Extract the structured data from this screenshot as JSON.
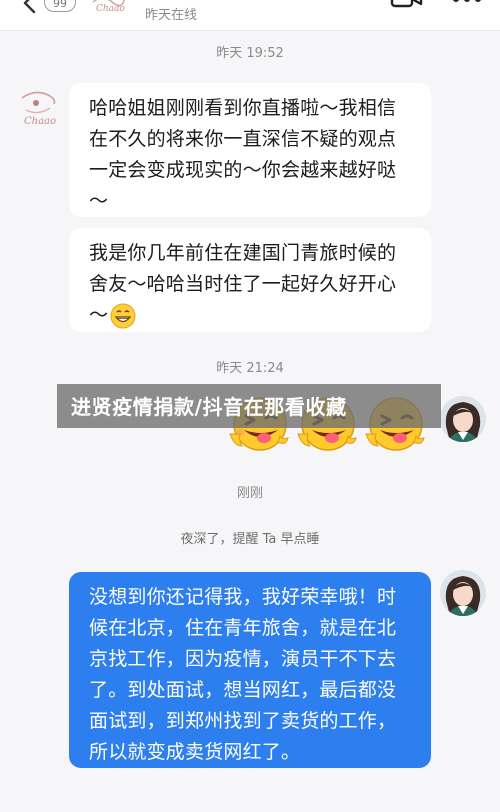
{
  "header": {
    "unread_count": "99",
    "contact_status": "昨天在线"
  },
  "chat": {
    "timestamps": [
      "昨天 19:52",
      "昨天 21:24",
      "刚刚"
    ],
    "messages_in": [
      {
        "lines": [
          "哈哈姐姐刚刚看到你直播啦～我相信",
          "在不久的将来你一直深信不疑的观点",
          "一定会变成现实的～你会越来越好哒",
          "～"
        ]
      },
      {
        "lines": [
          "我是你几年前住在建国门青旅时候的",
          "舍友～哈哈当时住了一起好久好开心",
          "～"
        ]
      }
    ],
    "reminder": "夜深了，提醒 Ta 早点睡",
    "message_out": {
      "lines": [
        "没想到你还记得我，我好荣幸哦！时",
        "候在北京，住在青年旅舍，就是在北",
        "京找工作，因为疫情，演员干不下去",
        "了。到处面试，想当网红，最后都没",
        "面试到，到郑州找到了卖货的工作，",
        "所以就变成卖货网红了。"
      ]
    }
  },
  "overlay": {
    "caption": "进贤疫情捐款/抖音在那看收藏"
  },
  "colors": {
    "outgoing_bubble": "#2d7ff0",
    "incoming_bubble": "#ffffff",
    "background": "#f6f6f8"
  },
  "icons": [
    "back-arrow-icon",
    "video-call-icon",
    "more-icon",
    "grin-emoji-icon",
    "wink-tongue-emoji-icon"
  ]
}
